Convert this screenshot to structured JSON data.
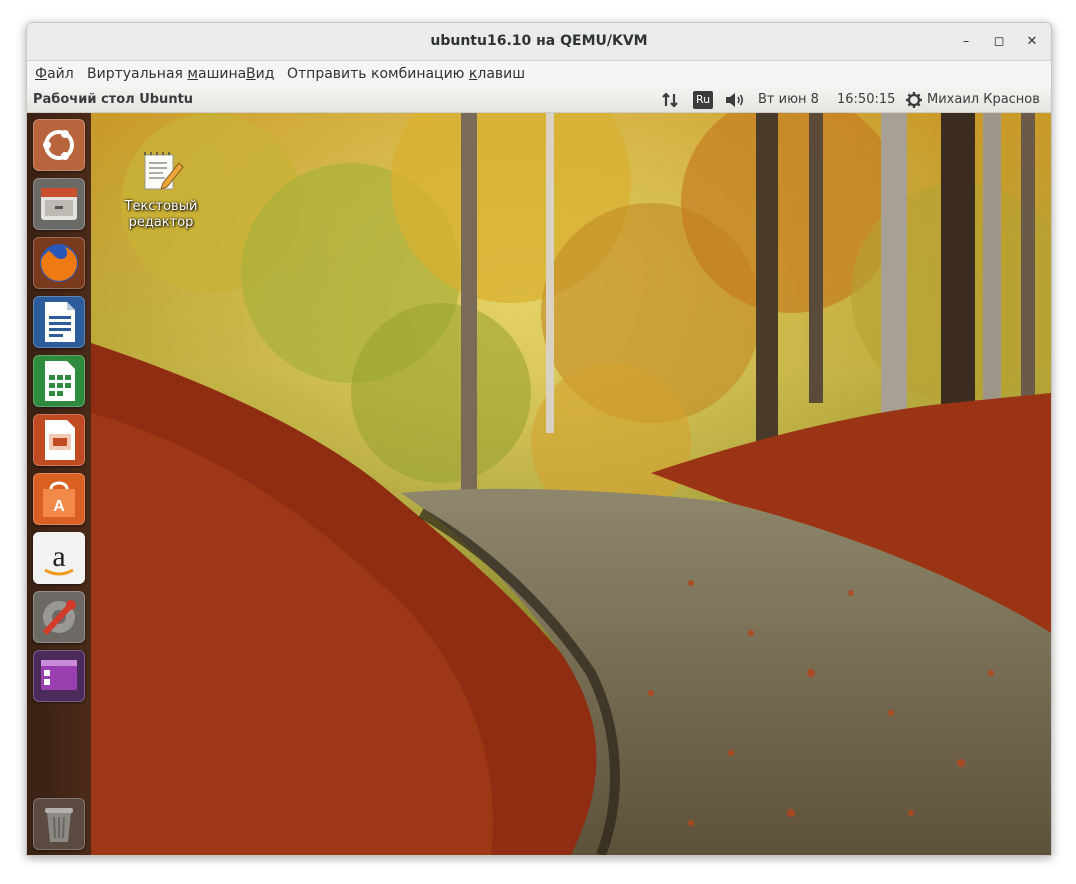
{
  "window": {
    "title": "ubuntu16.10 на QEMU/KVM"
  },
  "menubar": {
    "file": {
      "pre": "",
      "u": "Ф",
      "post": "айл"
    },
    "vm": {
      "pre": "Виртуальная ",
      "u": "м",
      "post": "ашина"
    },
    "view": {
      "pre": "",
      "u": "В",
      "post": "ид"
    },
    "sendkeys": {
      "pre": "Отправить комбинацию ",
      "u": "к",
      "post": "лавиш"
    }
  },
  "panel": {
    "title": "Рабочий стол Ubuntu",
    "keyboard_layout": "Ru",
    "date": "Вт июн  8",
    "time": "16:50:15",
    "user": "Михаил Краснов"
  },
  "desktop_icon": {
    "label_line1": "Текстовый",
    "label_line2": "редактор"
  },
  "launcher": [
    "ubuntu-dash-icon",
    "files-icon",
    "firefox-icon",
    "libreoffice-writer-icon",
    "libreoffice-calc-icon",
    "libreoffice-impress-icon",
    "ubuntu-software-icon",
    "amazon-icon",
    "system-settings-icon",
    "workspace-switcher-icon",
    "trash-icon"
  ]
}
